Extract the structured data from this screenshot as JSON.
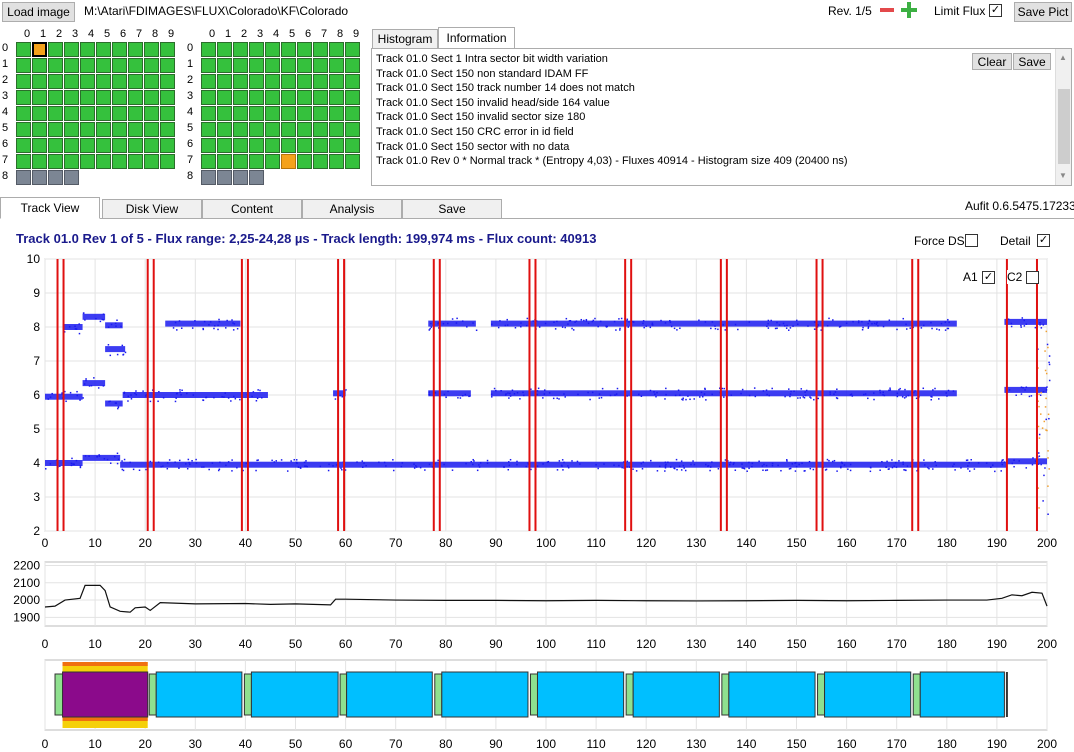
{
  "toolbar": {
    "load_label": "Load image",
    "path": "M:\\Atari\\FDIMAGES\\FLUX\\Colorado\\KF\\Colorado",
    "rev": "Rev. 1/5",
    "minus": "−",
    "plus": "+",
    "limit_flux": "Limit Flux",
    "limit_flux_checked": "✓",
    "save_pict": "Save Pict"
  },
  "side_grids": {
    "col_labels": [
      "0",
      "1",
      "2",
      "3",
      "4",
      "5",
      "6",
      "7",
      "8",
      "9"
    ],
    "row_labels": [
      "0",
      "1",
      "2",
      "3",
      "4",
      "5",
      "6",
      "7",
      "8"
    ]
  },
  "info_panel": {
    "tabs": [
      "Histogram",
      "Information"
    ],
    "active_tab": "Information",
    "clear": "Clear",
    "save": "Save",
    "lines": [
      "Track 01.0 Sect 1 Intra sector bit width variation",
      "Track 01.0 Sect 150 non standard IDAM FF",
      "Track 01.0 Sect 150 track number 14 does not match",
      "Track 01.0 Sect 150 invalid head/side 164 value",
      "Track 01.0 Sect 150 invalid sector size 180",
      "Track 01.0 Sect 150 CRC error in id field",
      "Track 01.0 Sect 150 sector with no data",
      "Track 01.0 Rev 0 * Normal track * (Entropy 4,03) - Fluxes 40914 - Histogram size 409 (20400 ns)"
    ]
  },
  "main_tabs": [
    "Track View",
    "Disk View",
    "Content",
    "Analysis",
    "Save"
  ],
  "active_main_tab": "Track View",
  "version": "Aufit 0.6.5475.17233",
  "track_title": "Track 01.0 Rev 1 of 5 - Flux range: 2,25-24,28 µs - Track length: 199,974 ms - Flux count: 40913",
  "options": {
    "force_ds": "Force DS",
    "force_ds_checked": "",
    "detail": "Detail",
    "detail_checked": "✓",
    "a1": "A1",
    "a1_checked": "✓",
    "c2": "C2",
    "c2_checked": ""
  },
  "colors": {
    "flux": "#1a1af0",
    "marker": "#e01010",
    "sector_fill": "#00bfff",
    "sector_bad": "#8b0a8b",
    "id_field": "#8fe08f",
    "cell_good": "#35c13d",
    "cell_selected": "#f4a21c",
    "cell_missing": "#7c8694"
  },
  "chart_data": [
    {
      "type": "scatter",
      "title": "",
      "xlim": [
        0,
        200
      ],
      "ylim": [
        2,
        10
      ],
      "x_ticks": [
        0,
        10,
        20,
        30,
        40,
        50,
        60,
        70,
        80,
        90,
        100,
        110,
        120,
        130,
        140,
        150,
        160,
        170,
        180,
        190,
        200
      ],
      "y_ticks": [
        2,
        3,
        4,
        5,
        6,
        7,
        8,
        9,
        10
      ],
      "markers_x": [
        2.5,
        3.7,
        20.5,
        21.7,
        39.3,
        40.5,
        58.5,
        59.7,
        77.6,
        78.8,
        96.7,
        97.9,
        115.8,
        117.0,
        134.9,
        136.1,
        154.0,
        155.2,
        173.1,
        174.3,
        192.0,
        198.0
      ],
      "series": [
        {
          "segments": [
            {
              "x0": 0,
              "x1": 7.5,
              "y": 4.0
            },
            {
              "x0": 7.5,
              "x1": 15,
              "y": 4.15
            },
            {
              "x0": 15,
              "x1": 192,
              "y": 3.95
            },
            {
              "x0": 192,
              "x1": 200,
              "y": 4.05
            }
          ]
        },
        {
          "segments": [
            {
              "x0": 0,
              "x1": 7.5,
              "y": 5.95
            },
            {
              "x0": 7.5,
              "x1": 12,
              "y": 6.35
            },
            {
              "x0": 12,
              "x1": 15.5,
              "y": 5.75
            },
            {
              "x0": 15.5,
              "x1": 44.5,
              "y": 6.0
            },
            {
              "x0": 57.5,
              "x1": 60,
              "y": 6.05
            },
            {
              "x0": 76.5,
              "x1": 85,
              "y": 6.05
            },
            {
              "x0": 89,
              "x1": 182,
              "y": 6.05
            },
            {
              "x0": 191.5,
              "x1": 200,
              "y": 6.15
            }
          ]
        },
        {
          "segments": [
            {
              "x0": 3.5,
              "x1": 7.5,
              "y": 8.0
            },
            {
              "x0": 7.5,
              "x1": 12,
              "y": 8.3
            },
            {
              "x0": 12,
              "x1": 15.5,
              "y": 8.05
            },
            {
              "x0": 24,
              "x1": 39,
              "y": 8.1
            },
            {
              "x0": 76.5,
              "x1": 86,
              "y": 8.1
            },
            {
              "x0": 89,
              "x1": 182,
              "y": 8.1
            },
            {
              "x0": 191.5,
              "x1": 200,
              "y": 8.15
            }
          ]
        },
        {
          "segments": [
            {
              "x0": 12,
              "x1": 16,
              "y": 7.35
            }
          ]
        }
      ]
    },
    {
      "type": "line",
      "xlim": [
        0,
        200
      ],
      "ylim": [
        1850,
        2220
      ],
      "y_ticks": [
        1900,
        2000,
        2100,
        2200
      ],
      "x_ticks": [
        0,
        10,
        20,
        30,
        40,
        50,
        60,
        70,
        80,
        90,
        100,
        110,
        120,
        130,
        140,
        150,
        160,
        170,
        180,
        190,
        200
      ],
      "points": [
        [
          0,
          1960
        ],
        [
          2,
          1965
        ],
        [
          4,
          2000
        ],
        [
          7,
          2010
        ],
        [
          8,
          2085
        ],
        [
          11,
          2085
        ],
        [
          12,
          2055
        ],
        [
          13,
          1960
        ],
        [
          15,
          1935
        ],
        [
          17,
          1930
        ],
        [
          18,
          1955
        ],
        [
          20,
          1960
        ],
        [
          21,
          1940
        ],
        [
          23,
          1985
        ],
        [
          30,
          1978
        ],
        [
          40,
          1980
        ],
        [
          45,
          1975
        ],
        [
          50,
          1978
        ],
        [
          57,
          1972
        ],
        [
          58,
          2005
        ],
        [
          60,
          2005
        ],
        [
          70,
          2000
        ],
        [
          80,
          1998
        ],
        [
          90,
          1998
        ],
        [
          100,
          1996
        ],
        [
          110,
          1998
        ],
        [
          120,
          1996
        ],
        [
          130,
          1995
        ],
        [
          140,
          1996
        ],
        [
          150,
          1998
        ],
        [
          160,
          1996
        ],
        [
          170,
          1998
        ],
        [
          180,
          2000
        ],
        [
          188,
          2000
        ],
        [
          191,
          2010
        ],
        [
          193,
          2030
        ],
        [
          195,
          2025
        ],
        [
          197,
          2045
        ],
        [
          199,
          2040
        ],
        [
          200,
          1965
        ]
      ]
    },
    {
      "type": "bar",
      "xlim": [
        0,
        200
      ],
      "x_ticks": [
        0,
        10,
        20,
        30,
        40,
        50,
        60,
        70,
        80,
        90,
        100,
        110,
        120,
        130,
        140,
        150,
        160,
        170,
        180,
        190,
        200
      ],
      "sectors": [
        {
          "id_start": 2.0,
          "data_start": 3.5,
          "end": 20.5,
          "bad": true
        },
        {
          "id_start": 20.8,
          "data_start": 22.2,
          "end": 39.3,
          "bad": false
        },
        {
          "id_start": 39.8,
          "data_start": 41.2,
          "end": 58.5,
          "bad": false
        },
        {
          "id_start": 58.9,
          "data_start": 60.2,
          "end": 77.3,
          "bad": false
        },
        {
          "id_start": 77.8,
          "data_start": 79.2,
          "end": 96.4,
          "bad": false
        },
        {
          "id_start": 96.9,
          "data_start": 98.3,
          "end": 115.5,
          "bad": false
        },
        {
          "id_start": 116.0,
          "data_start": 117.4,
          "end": 134.6,
          "bad": false
        },
        {
          "id_start": 135.1,
          "data_start": 136.5,
          "end": 153.7,
          "bad": false
        },
        {
          "id_start": 154.2,
          "data_start": 155.6,
          "end": 172.8,
          "bad": false
        },
        {
          "id_start": 173.3,
          "data_start": 174.7,
          "end": 191.5,
          "bad": false
        }
      ]
    }
  ]
}
